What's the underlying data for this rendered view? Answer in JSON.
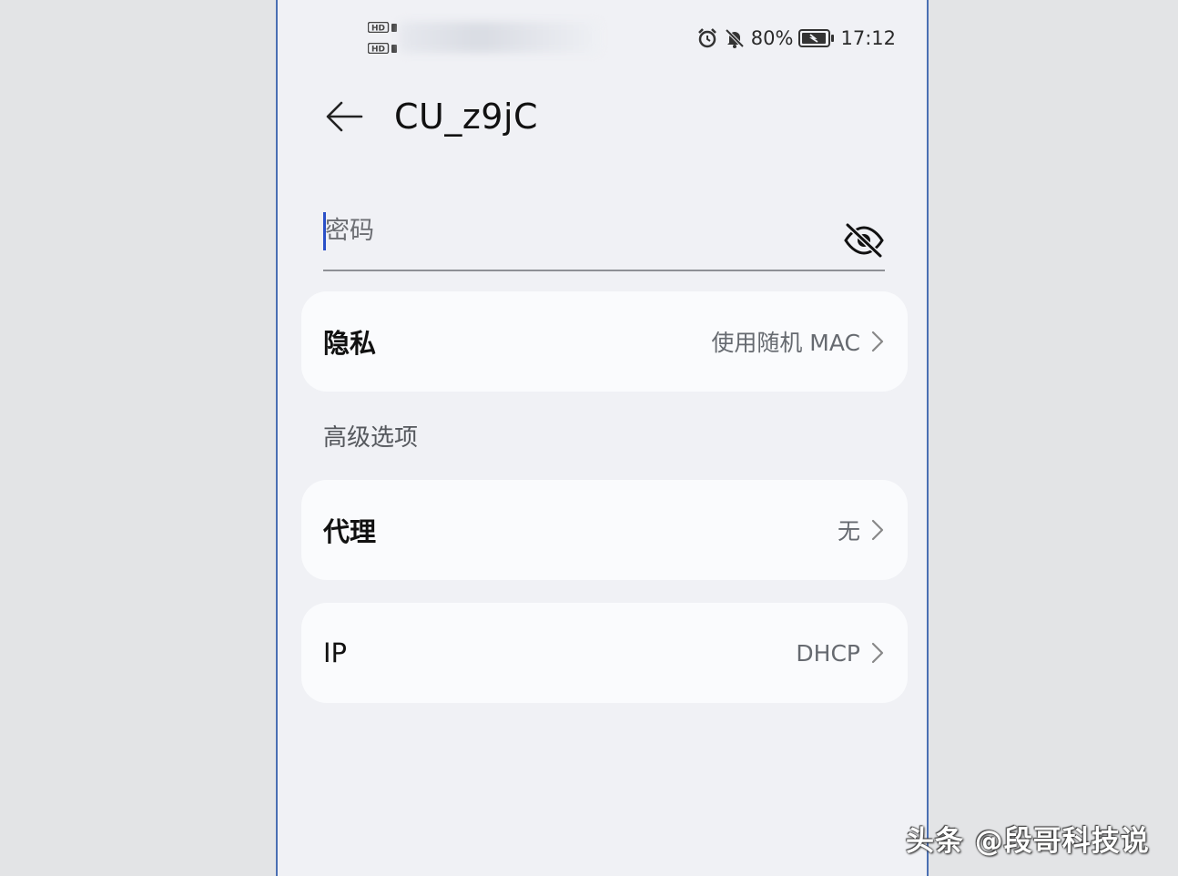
{
  "status_bar": {
    "sim1_label": "HD",
    "sim2_label": "HD",
    "icons": [
      "alarm-icon",
      "bell-muted-icon",
      "battery-charging-icon"
    ],
    "battery_percent": "80%",
    "time": "17:12"
  },
  "header": {
    "back_icon": "arrow-left-icon",
    "title": "CU_z9jC"
  },
  "password": {
    "placeholder": "密码",
    "value": "",
    "visibility_icon": "eye-slash-icon"
  },
  "privacy": {
    "label": "隐私",
    "value": "使用随机 MAC"
  },
  "advanced": {
    "header": "高级选项"
  },
  "proxy": {
    "label": "代理",
    "value": "无"
  },
  "ip": {
    "label": "IP",
    "value": "DHCP"
  },
  "watermark": "头条 @段哥科技说",
  "colors": {
    "accent": "#2a50c8",
    "background": "#f0f1f5",
    "card": "#fafbfd",
    "frame": "#4a6fb3"
  }
}
